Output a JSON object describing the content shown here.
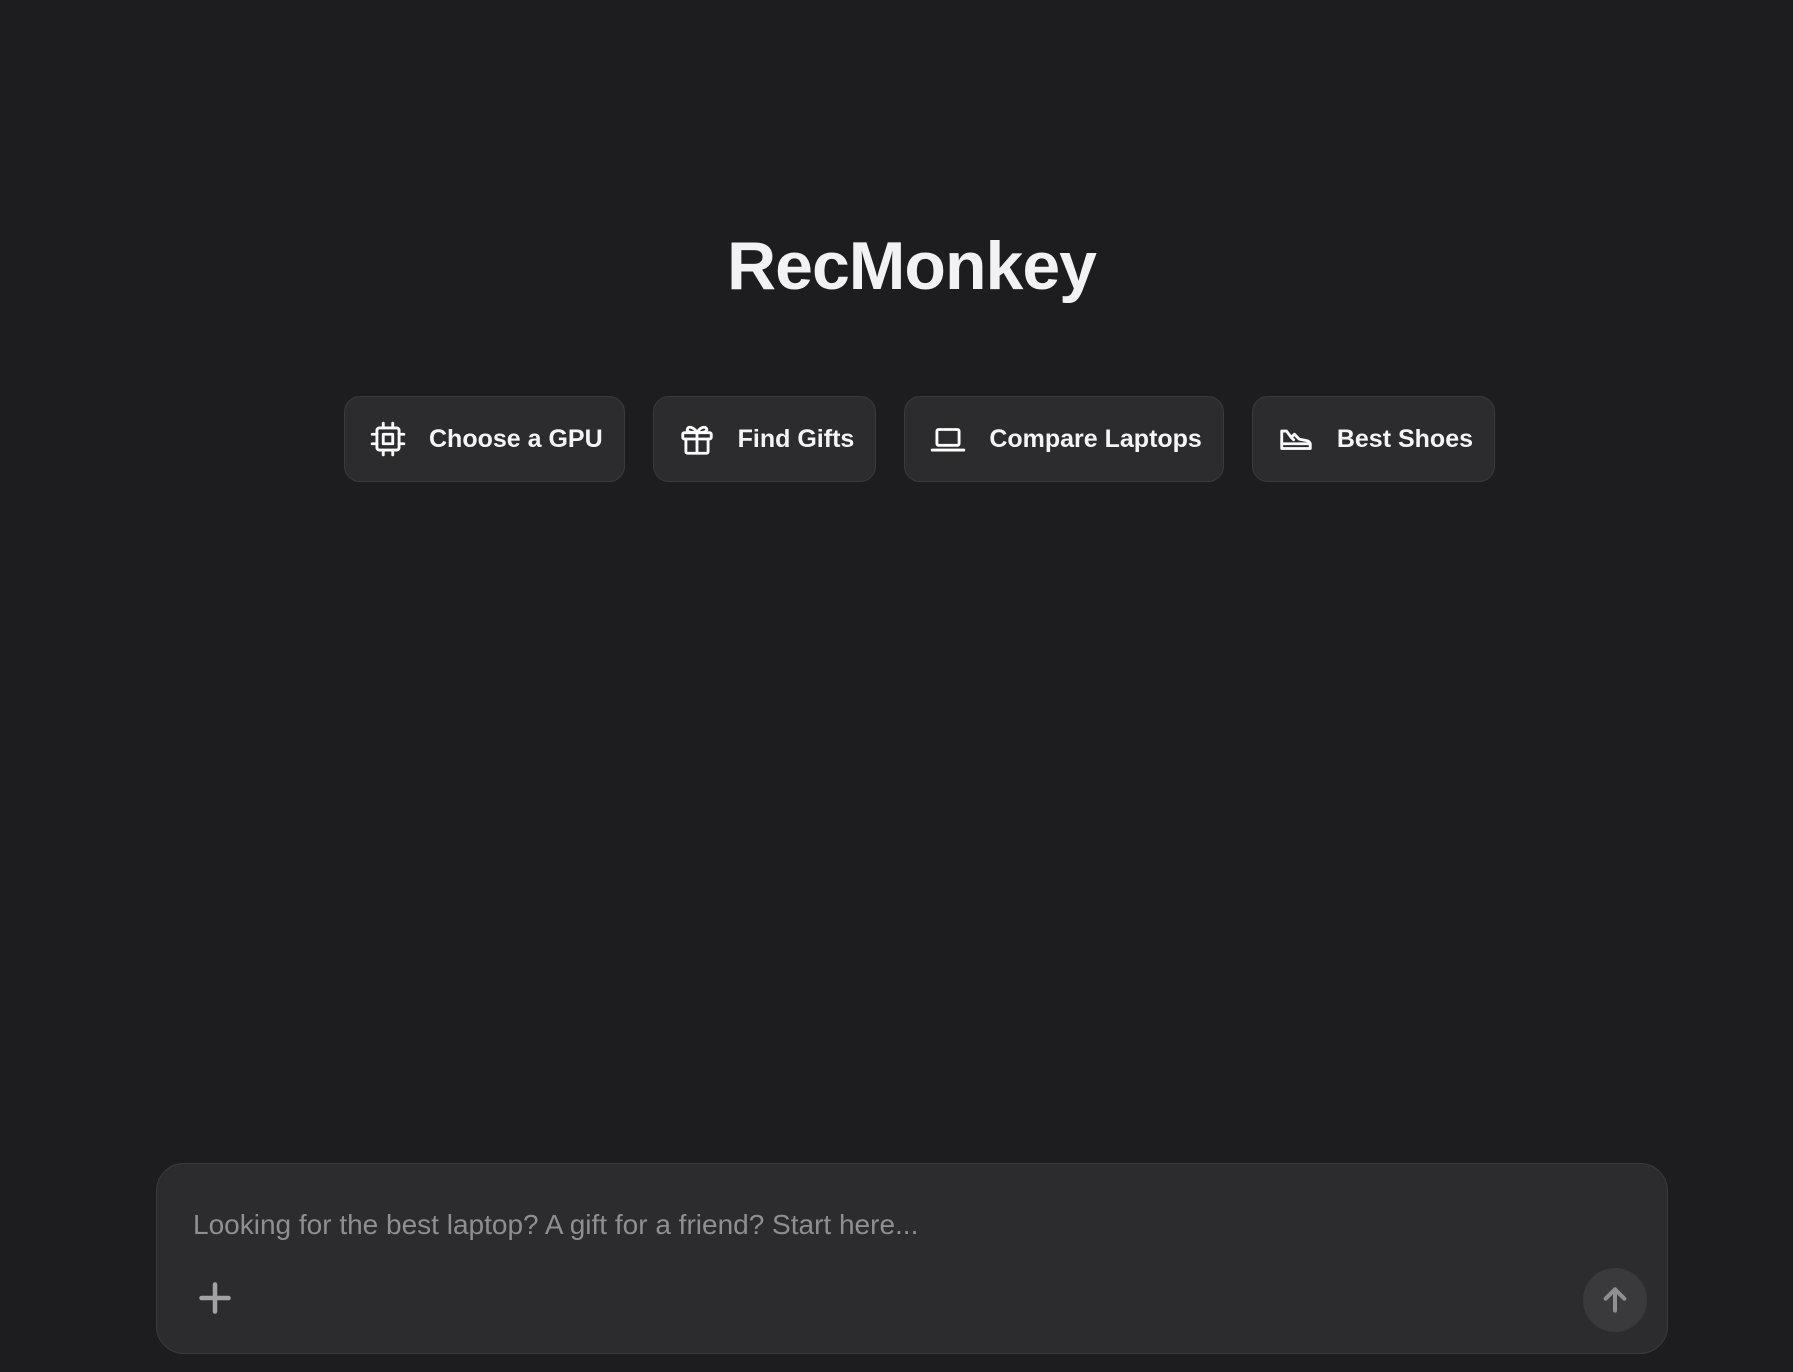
{
  "app": {
    "title": "RecMonkey"
  },
  "suggestions": [
    {
      "label": "Choose a GPU",
      "icon": "cpu-icon"
    },
    {
      "label": "Find Gifts",
      "icon": "gift-icon"
    },
    {
      "label": "Compare Laptops",
      "icon": "laptop-icon"
    },
    {
      "label": "Best Shoes",
      "icon": "shoe-icon"
    }
  ],
  "composer": {
    "placeholder": "Looking for the best laptop? A gift for a friend? Start here...",
    "value": "",
    "add_icon": "plus-icon",
    "send_icon": "arrow-up-icon"
  },
  "colors": {
    "background": "#1d1d1f",
    "surface": "#2c2c2e",
    "border": "#3a3a3d",
    "text": "#f5f5f7",
    "muted": "#8e8e93"
  }
}
